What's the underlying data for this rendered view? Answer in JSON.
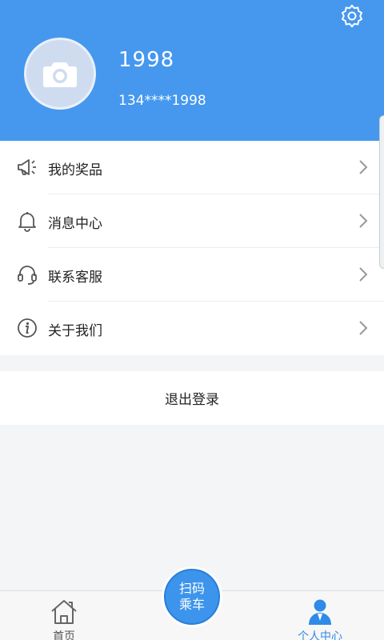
{
  "profile": {
    "username": "1998",
    "phone": "134****1998"
  },
  "menu": [
    {
      "label": "我的奖品",
      "icon": "megaphone-icon"
    },
    {
      "label": "消息中心",
      "icon": "bell-icon"
    },
    {
      "label": "联系客服",
      "icon": "headset-icon"
    },
    {
      "label": "关于我们",
      "icon": "info-icon"
    }
  ],
  "logout_label": "退出登录",
  "tabbar": {
    "home_label": "首页",
    "scan_line1": "扫码",
    "scan_line2": "乘车",
    "profile_label": "个人中心"
  },
  "colors": {
    "header": "#4598ee",
    "accent": "#2f8ae8"
  }
}
